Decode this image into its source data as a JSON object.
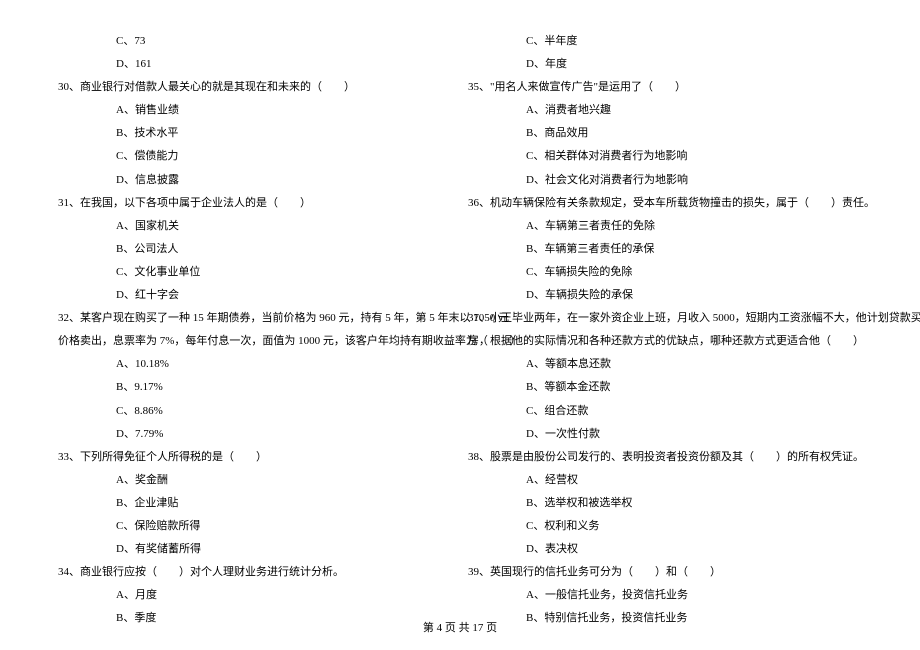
{
  "footer": "第 4 页 共 17 页",
  "left": {
    "q29_c": "C、73",
    "q29_d": "D、161",
    "q30": "30、商业银行对借款人最关心的就是其现在和未来的（　　）",
    "q30_a": "A、销售业绩",
    "q30_b": "B、技术水平",
    "q30_c": "C、偿债能力",
    "q30_d": "D、信息披露",
    "q31": "31、在我国，以下各项中属于企业法人的是（　　）",
    "q31_a": "A、国家机关",
    "q31_b": "B、公司法人",
    "q31_c": "C、文化事业单位",
    "q31_d": "D、红十字会",
    "q32_l1": "32、某客户现在购买了一种 15 年期债券，当前价格为 960 元，持有 5 年，第 5 年末以 1050 元",
    "q32_l2": "价格卖出，息票率为 7%，每年付息一次，面值为 1000 元，该客户年均持有期收益率为（　　）",
    "q32_a": "A、10.18%",
    "q32_b": "B、9.17%",
    "q32_c": "C、8.86%",
    "q32_d": "D、7.79%",
    "q33": "33、下列所得免征个人所得税的是（　　）",
    "q33_a": "A、奖金酬",
    "q33_b": "B、企业津贴",
    "q33_c": "C、保险赔款所得",
    "q33_d": "D、有奖储蓄所得",
    "q34": "34、商业银行应按（　　）对个人理财业务进行统计分析。",
    "q34_a": "A、月度",
    "q34_b": "B、季度"
  },
  "right": {
    "q34_c": "C、半年度",
    "q34_d": "D、年度",
    "q35": "35、\"用名人来做宣传广告\"是运用了（　　）",
    "q35_a": "A、消费者地兴趣",
    "q35_b": "B、商品效用",
    "q35_c": "C、相关群体对消费者行为地影响",
    "q35_d": "D、社会文化对消费者行为地影响",
    "q36": "36、机动车辆保险有关条款规定，受本车所载货物撞击的损失，属于（　　）责任。",
    "q36_a": "A、车辆第三者责任的免除",
    "q36_b": "B、车辆第三者责任的承保",
    "q36_c": "C、车辆损失险的免除",
    "q36_d": "D、车辆损失险的承保",
    "q37_l1": "37、小王毕业两年，在一家外资企业上班，月收入 5000，短期内工资涨幅不大，他计划贷款买",
    "q37_l2": "房，根据他的实际情况和各种还款方式的优缺点，哪种还款方式更适合他（　　）",
    "q37_a": "A、等额本息还款",
    "q37_b": "B、等额本金还款",
    "q37_c": "C、组合还款",
    "q37_d": "D、一次性付款",
    "q38": "38、股票是由股份公司发行的、表明投资者投资份额及其（　　）的所有权凭证。",
    "q38_a": "A、经营权",
    "q38_b": "B、选举权和被选举权",
    "q38_c": "C、权利和义务",
    "q38_d": "D、表决权",
    "q39": "39、英国现行的信托业务可分为（　　）和（　　）",
    "q39_a": "A、一般信托业务，投资信托业务",
    "q39_b": "B、特别信托业务，投资信托业务"
  }
}
